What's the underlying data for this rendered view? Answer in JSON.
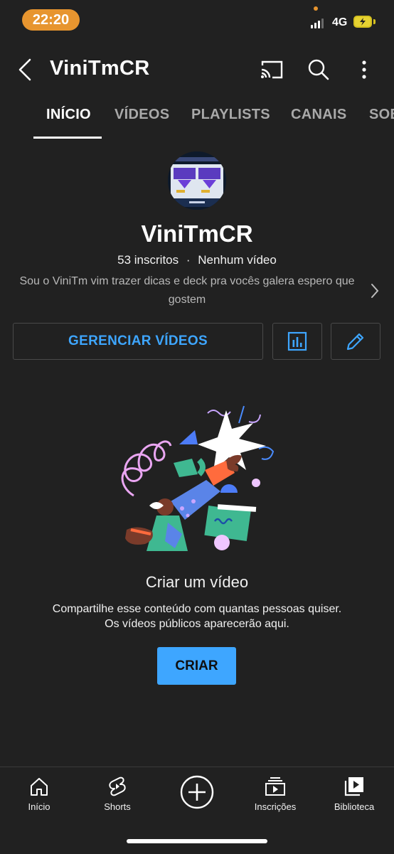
{
  "status_bar": {
    "time": "22:20",
    "network": "4G"
  },
  "header": {
    "title": "ViniTmCR"
  },
  "tabs": [
    {
      "label": "INÍCIO",
      "active": true
    },
    {
      "label": "VÍDEOS"
    },
    {
      "label": "PLAYLISTS"
    },
    {
      "label": "CANAIS"
    },
    {
      "label": "SOB"
    }
  ],
  "channel": {
    "name": "ViniTmCR",
    "subscribers": "53 inscritos",
    "separator": "·",
    "videos": "Nenhum vídeo",
    "description": "Sou o ViniTm vim trazer dicas e deck pra vocês galera espero que gostem"
  },
  "actions": {
    "manage_label": "GERENCIAR VÍDEOS"
  },
  "empty_state": {
    "title": "Criar um vídeo",
    "line1": "Compartilhe esse conteúdo com quantas pessoas quiser.",
    "line2": "Os vídeos públicos aparecerão aqui.",
    "button_label": "CRIAR"
  },
  "bottom_nav": [
    {
      "label": "Início",
      "icon": "home-icon"
    },
    {
      "label": "Shorts",
      "icon": "shorts-icon"
    },
    {
      "label": "",
      "icon": "create-plus-icon"
    },
    {
      "label": "Inscrições",
      "icon": "subscriptions-icon"
    },
    {
      "label": "Biblioteca",
      "icon": "library-icon"
    }
  ],
  "colors": {
    "accent": "#3ea6ff",
    "background": "#212121",
    "status_pill": "#e7952f"
  }
}
